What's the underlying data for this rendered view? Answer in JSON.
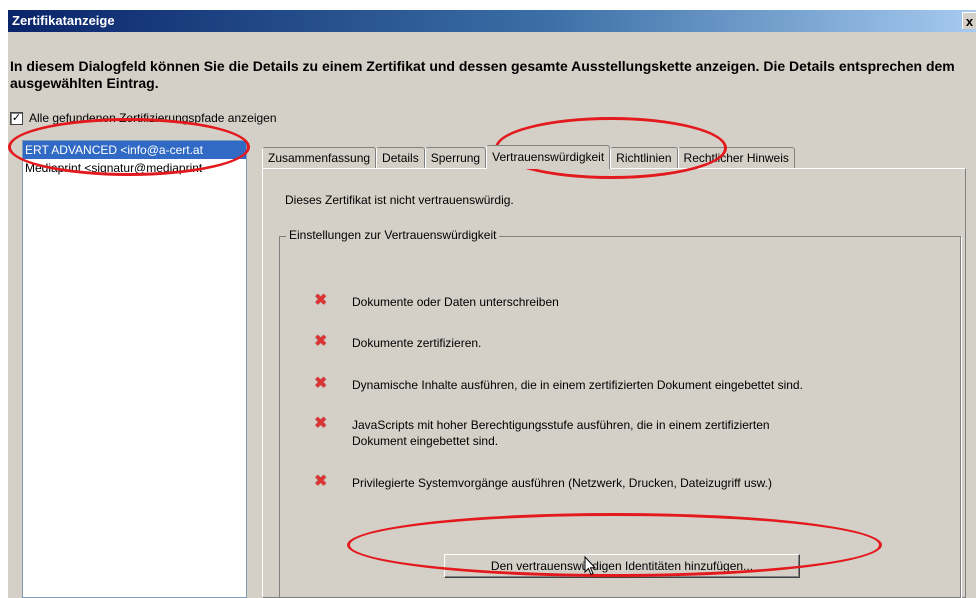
{
  "window": {
    "title": "Zertifikatanzeige",
    "close_label": "x"
  },
  "intro_text": "In diesem Dialogfeld können Sie die Details zu einem Zertifikat und dessen gesamte Ausstellungskette anzeigen. Die Details entsprechen dem ausgewählten Eintrag.",
  "show_all_paths": {
    "checked_glyph": "✓",
    "label": "Alle gefundenen Zertifizierungspfade anzeigen"
  },
  "chain": [
    {
      "label": "ERT ADVANCED <info@a-cert.at",
      "selected": true
    },
    {
      "label": "Mediaprint <signatur@mediaprint",
      "selected": false
    }
  ],
  "tabs": [
    {
      "label": "Zusammenfassung"
    },
    {
      "label": "Details"
    },
    {
      "label": "Sperrung"
    },
    {
      "label": "Vertrauenswürdigkeit",
      "active": true
    },
    {
      "label": "Richtlinien"
    },
    {
      "label": "Rechtlicher Hinweis"
    }
  ],
  "trust": {
    "status_text": "Dieses Zertifikat ist nicht vertrauenswürdig.",
    "group_title": "Einstellungen zur Vertrauenswürdigkeit",
    "deny_glyph": "✖",
    "permissions": [
      "Dokumente oder Daten unterschreiben",
      "Dokumente zertifizieren.",
      "Dynamische Inhalte ausführen, die in einem zertifizierten Dokument eingebettet sind.",
      "JavaScripts mit hoher Berechtigungsstufe ausführen, die in einem zertifizierten Dokument eingebettet sind.",
      "Privilegierte Systemvorgänge ausführen (Netzwerk, Drucken, Dateizugriff usw.)"
    ],
    "add_button_label": "Den vertrauenswürdigen Identitäten hinzufügen..."
  },
  "colors": {
    "dialog_bg": "#d4d0c8",
    "title_start": "#0a246a",
    "selection": "#316ac5",
    "annotation_red": "#e3191d",
    "deny_red": "#d33333"
  }
}
